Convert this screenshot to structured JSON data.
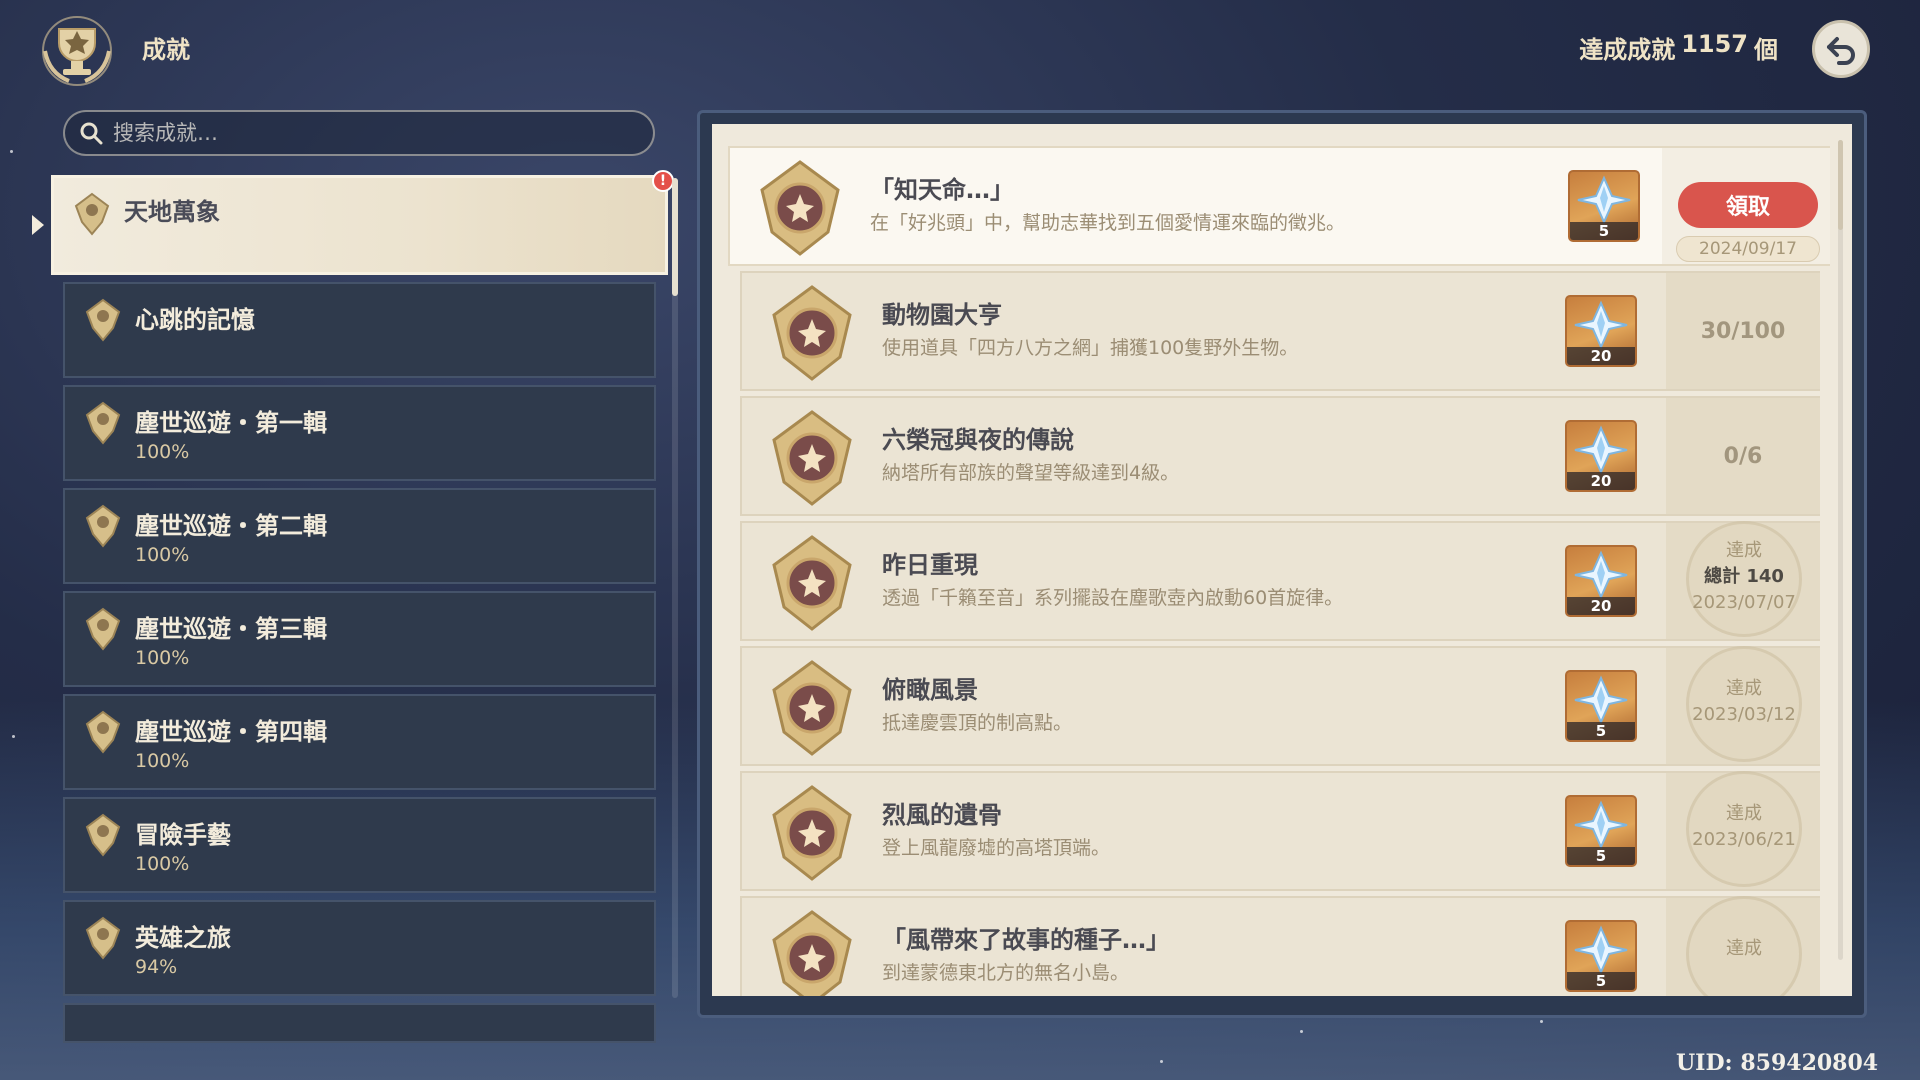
{
  "header": {
    "title": "成就",
    "count_label": "達成成就",
    "count_value": "1157",
    "count_unit": "個"
  },
  "search": {
    "placeholder": "搜索成就…"
  },
  "categories": [
    {
      "name": "天地萬象",
      "percent": "",
      "selected": true,
      "has_notification": true
    },
    {
      "name": "心跳的記憶",
      "percent": ""
    },
    {
      "name": "塵世巡遊・第一輯",
      "percent": "100%"
    },
    {
      "name": "塵世巡遊・第二輯",
      "percent": "100%"
    },
    {
      "name": "塵世巡遊・第三輯",
      "percent": "100%"
    },
    {
      "name": "塵世巡遊・第四輯",
      "percent": "100%"
    },
    {
      "name": "冒險手藝",
      "percent": "100%"
    },
    {
      "name": "英雄之旅",
      "percent": "94%"
    }
  ],
  "notification_mark": "!",
  "achievements": [
    {
      "title": "「知天命…」",
      "desc": "在「好兆頭」中，幫助志華找到五個愛情運來臨的徵兆。",
      "reward": "5",
      "status": "claim",
      "claim_label": "領取",
      "date": "2024/09/17"
    },
    {
      "title": "動物園大亨",
      "desc": "使用道具「四方八方之網」捕獲100隻野外生物。",
      "reward": "20",
      "status": "progress",
      "progress": "30/100"
    },
    {
      "title": "六榮冠與夜的傳說",
      "desc": "納塔所有部族的聲望等級達到4級。",
      "reward": "20",
      "status": "progress",
      "progress": "0/6"
    },
    {
      "title": "昨日重現",
      "desc": "透過「千籟至音」系列擺設在塵歌壺內啟動60首旋律。",
      "reward": "20",
      "status": "done",
      "done_label": "達成",
      "total": "總計 140",
      "date": "2023/07/07"
    },
    {
      "title": "俯瞰風景",
      "desc": "抵達慶雲頂的制高點。",
      "reward": "5",
      "status": "done",
      "done_label": "達成",
      "total": "",
      "date": "2023/03/12"
    },
    {
      "title": "烈風的遺骨",
      "desc": "登上風龍廢墟的高塔頂端。",
      "reward": "5",
      "status": "done",
      "done_label": "達成",
      "total": "",
      "date": "2023/06/21"
    },
    {
      "title": "「風帶來了故事的種子…」",
      "desc": "到達蒙德東北方的無名小島。",
      "reward": "5",
      "status": "done",
      "done_label": "達成",
      "total": "",
      "date": ""
    }
  ],
  "uid": "UID: 859420804",
  "icons": {
    "emblem": "trophy-emblem-icon",
    "back": "back-arrow-icon",
    "search": "search-icon",
    "medal": "achievement-medal-icon",
    "reward": "primogem-icon"
  },
  "colors": {
    "claim_button": "#d9554d",
    "panel_bg": "#efe9dc",
    "accent_gold": "#d9c9a4"
  }
}
